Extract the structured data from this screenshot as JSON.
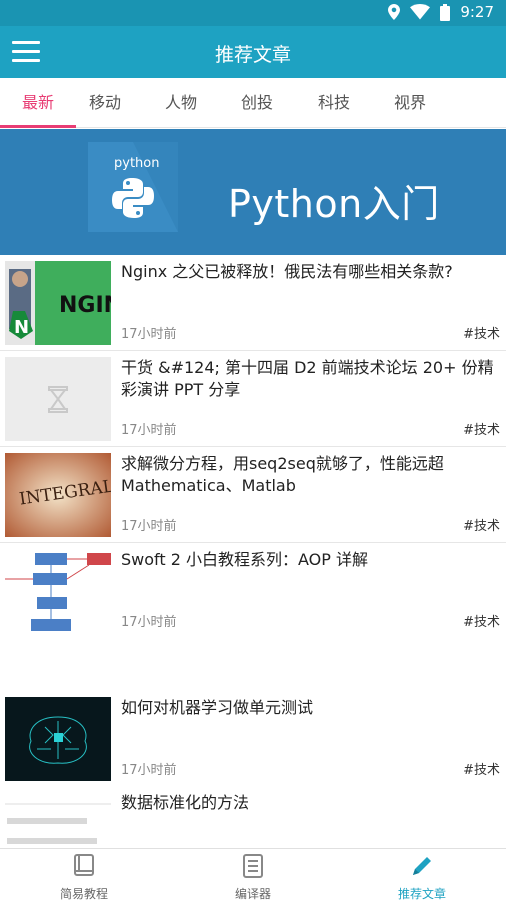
{
  "status_bar": {
    "time": "9:27",
    "icons": [
      "location-icon",
      "wifi-icon",
      "battery-icon"
    ]
  },
  "app_bar": {
    "title": "推荐文章",
    "menu_icon": "menu-icon"
  },
  "tabs": [
    {
      "label": "最新",
      "active": true
    },
    {
      "label": "移动",
      "active": false
    },
    {
      "label": "人物",
      "active": false
    },
    {
      "label": "创投",
      "active": false
    },
    {
      "label": "科技",
      "active": false
    },
    {
      "label": "视界",
      "active": false
    }
  ],
  "banner": {
    "logo_text": "python",
    "title": "Python入门"
  },
  "articles": [
    {
      "title": "Nginx 之父已被释放！俄民法有哪些相关条款?",
      "time": "17小时前",
      "tag": "#技术",
      "thumb_text": "NGIN"
    },
    {
      "title": "干货 &#124; 第十四届 D2 前端技术论坛 20+ 份精彩演讲 PPT 分享",
      "time": "17小时前",
      "tag": "#技术",
      "thumb_text": ""
    },
    {
      "title": "求解微分方程，用seq2seq就够了，性能远超 Mathematica、Matlab",
      "time": "17小时前",
      "tag": "#技术",
      "thumb_text": "INTEGRAL"
    },
    {
      "title": "Swoft 2 小白教程系列：AOP 详解",
      "time": "17小时前",
      "tag": "#技术",
      "thumb_text": ""
    },
    {
      "title": "如何对机器学习做单元测试",
      "time": "17小时前",
      "tag": "#技术",
      "thumb_text": ""
    },
    {
      "title": "数据标准化的方法",
      "time": "",
      "tag": "",
      "thumb_text": ""
    }
  ],
  "bottom_nav": [
    {
      "label": "简易教程",
      "icon": "book-icon",
      "active": false
    },
    {
      "label": "编译器",
      "icon": "document-icon",
      "active": false
    },
    {
      "label": "推荐文章",
      "icon": "pencil-icon",
      "active": true
    }
  ],
  "colors": {
    "primary": "#1ea2c2",
    "accent": "#e83d74",
    "banner": "#2f7fb6"
  }
}
